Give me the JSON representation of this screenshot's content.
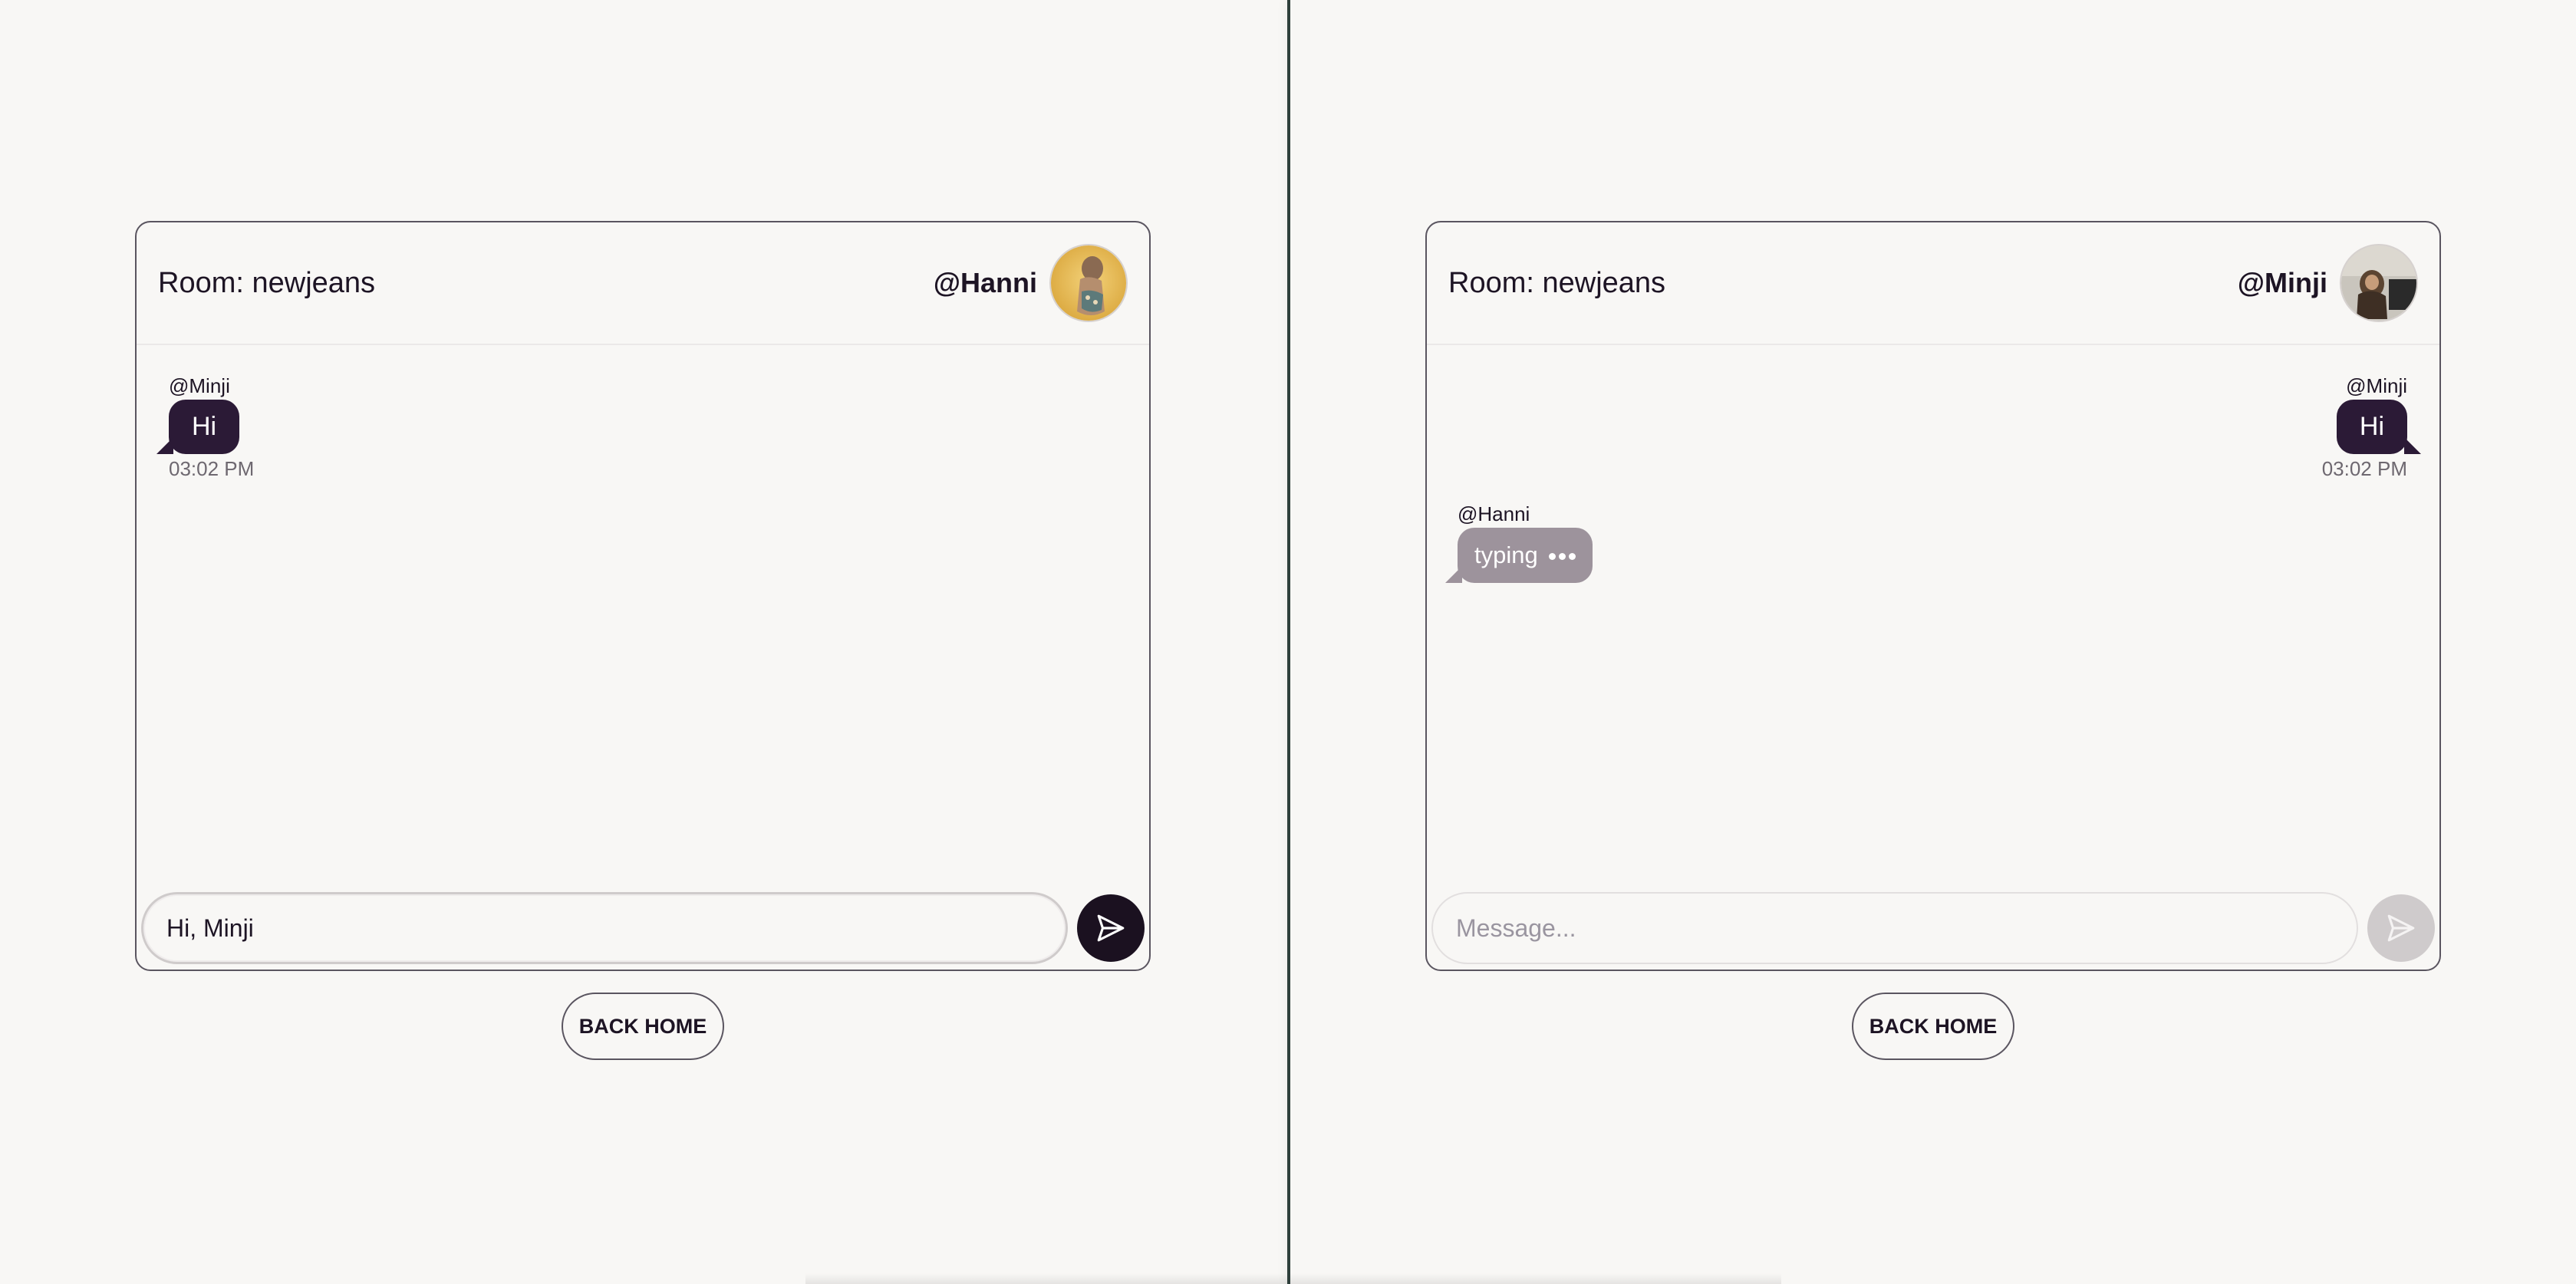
{
  "left_window": {
    "room_title": "Room: newjeans",
    "username": "@Hanni",
    "avatar_icon": "user-avatar-photo",
    "messages": [
      {
        "sender": "@Minji",
        "text": "Hi",
        "time": "03:02 PM"
      }
    ],
    "input_value": "Hi, Minji",
    "input_placeholder": "Message...",
    "send_icon": "send-arrow-icon",
    "back_label": "BACK HOME"
  },
  "right_window": {
    "room_title": "Room: newjeans",
    "username": "@Minji",
    "avatar_icon": "user-avatar-photo",
    "messages": [
      {
        "sender": "@Minji",
        "text": "Hi",
        "time": "03:02 PM"
      },
      {
        "sender": "@Hanni",
        "text": "typing"
      }
    ],
    "input_value": "",
    "input_placeholder": "Message...",
    "send_icon": "send-arrow-icon",
    "back_label": "BACK HOME"
  },
  "colors": {
    "background": "#f8f7f5",
    "own_bubble": "#2b1a36",
    "typing_bubble": "#9d939c",
    "send_active": "#1b1120",
    "send_disabled": "#cfcbcc"
  }
}
